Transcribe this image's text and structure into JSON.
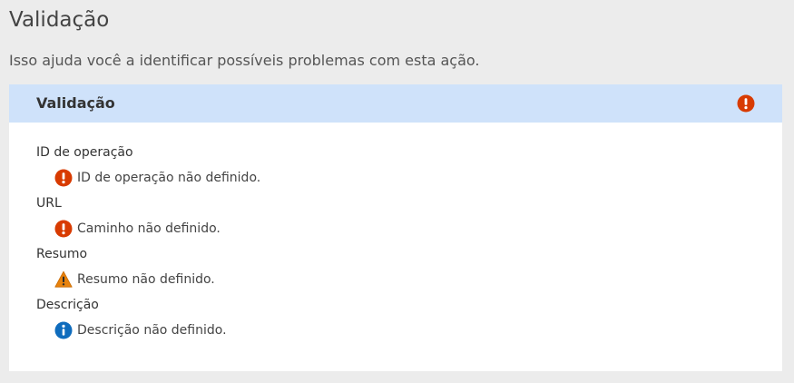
{
  "page": {
    "title": "Validação",
    "subtitle": "Isso ajuda você a identificar possíveis problemas com esta ação."
  },
  "panel": {
    "title": "Validação",
    "status_icon": "error-icon",
    "fields": [
      {
        "label": "ID de operação",
        "severity": "error",
        "icon": "error-icon",
        "message": "ID de operação não definido."
      },
      {
        "label": "URL",
        "severity": "error",
        "icon": "error-icon",
        "message": "Caminho não definido."
      },
      {
        "label": "Resumo",
        "severity": "warning",
        "icon": "warning-icon",
        "message": "Resumo não definido."
      },
      {
        "label": "Descrição",
        "severity": "info",
        "icon": "info-icon",
        "message": "Descrição não definido."
      }
    ]
  },
  "colors": {
    "background": "#ececec",
    "header_background": "#cfe2fa",
    "error": "#d83b01",
    "warning": "#e8820c",
    "info": "#0f6cbd"
  }
}
